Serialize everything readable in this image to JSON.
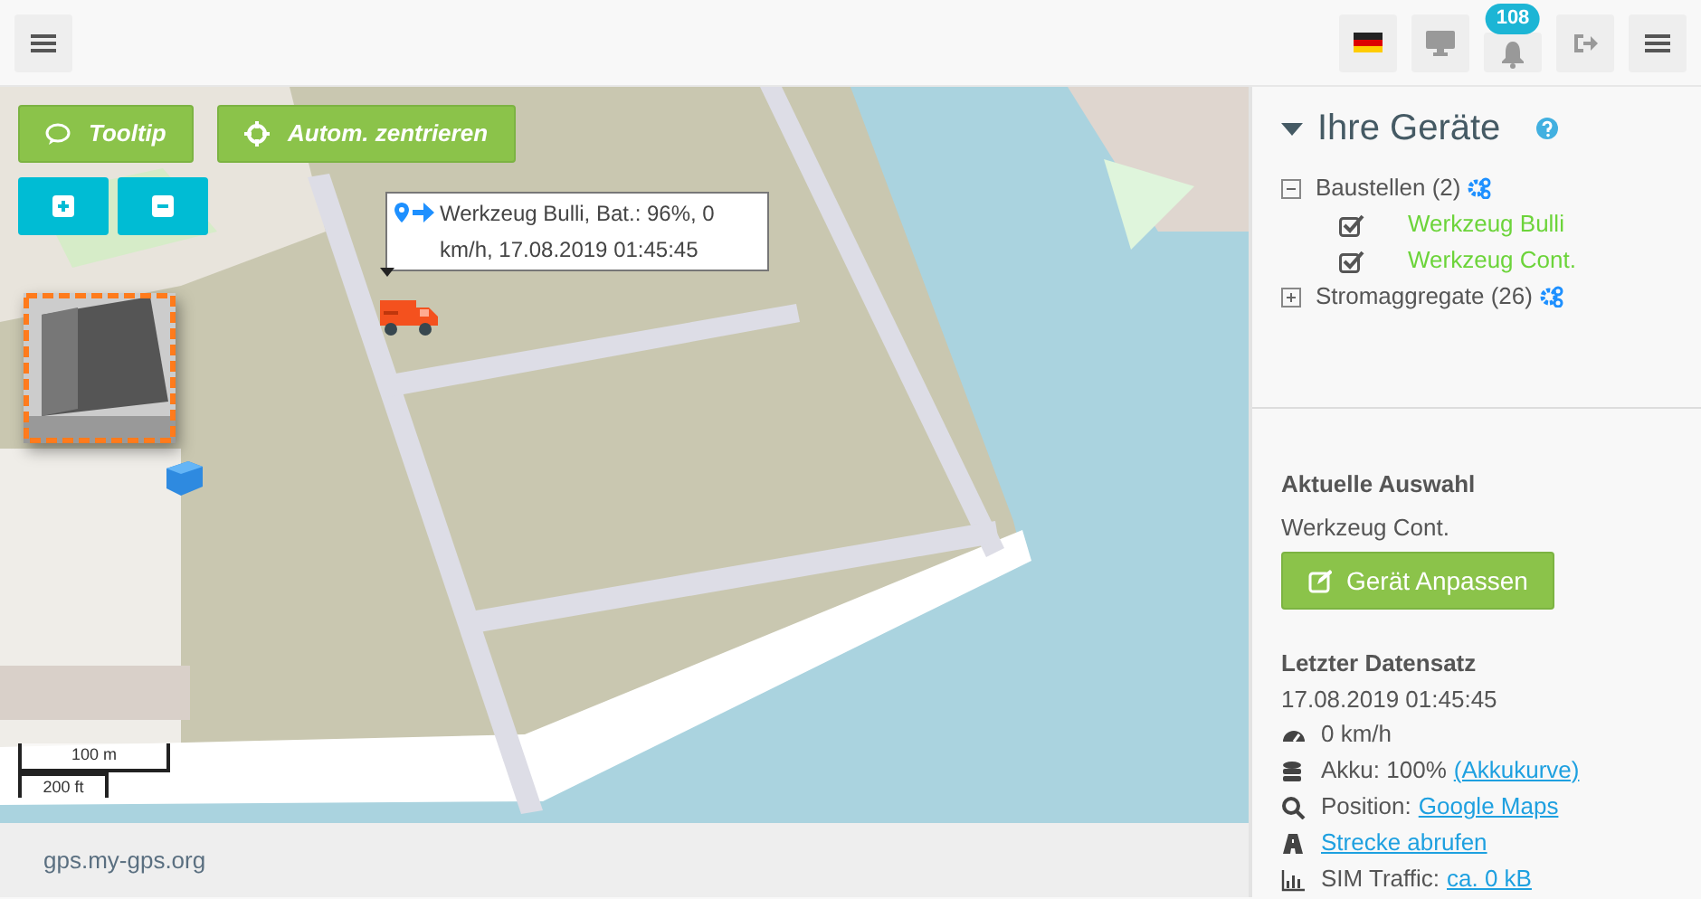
{
  "navbar": {
    "left_button": {
      "kind": "menu"
    },
    "right_buttons": [
      {
        "kind": "flag"
      },
      {
        "kind": "monitor"
      },
      {
        "kind": "bell",
        "badge": "108"
      },
      {
        "kind": "logout"
      },
      {
        "kind": "menu"
      }
    ]
  },
  "map": {
    "kind": "picture",
    "buttons": [
      {
        "label": "Tooltip",
        "kind": "tooltip"
      },
      {
        "label": "Autom. zentrieren",
        "kind": "center"
      }
    ],
    "zoom_buttons": [
      {
        "kind": "plus"
      },
      {
        "kind": "minus"
      }
    ],
    "popup": {
      "text": "Werkzeug Bulli, Bat.: 96%, 0 km/h, 17.08.2019 01:45:45"
    },
    "scale": {
      "metric": "100 m",
      "imperial": "200 ft"
    }
  },
  "footer": {
    "text": "gps.my-gps.org"
  },
  "sidebar": {
    "title": "Ihre Geräte",
    "expanded": true,
    "groups": [
      {
        "label": "Baustellen (2)",
        "expanded": true,
        "children": [
          {
            "label": "Werkzeug Bulli",
            "checked": true
          },
          {
            "label": "Werkzeug Cont.",
            "checked": true
          }
        ]
      },
      {
        "label": "Stromaggregate (26)",
        "expanded": false
      }
    ]
  },
  "selection": {
    "heading": "Aktuelle Auswahl",
    "value": "Werkzeug Cont.",
    "button": "Gerät Anpassen"
  },
  "last_record": {
    "heading": "Letzter Datensatz",
    "timestamp": "17.08.2019 01:45:45",
    "rows": [
      {
        "kind": "speed",
        "text": "0 km/h"
      },
      {
        "kind": "battery",
        "text": "Akku: 100%",
        "link": "(Akkukurve)"
      },
      {
        "kind": "position",
        "text": "Position:",
        "link": "Google Maps"
      },
      {
        "kind": "route",
        "link": "Strecke abrufen"
      },
      {
        "kind": "traffic",
        "text": "SIM Traffic:",
        "link": "ca. 0 kB"
      }
    ]
  }
}
